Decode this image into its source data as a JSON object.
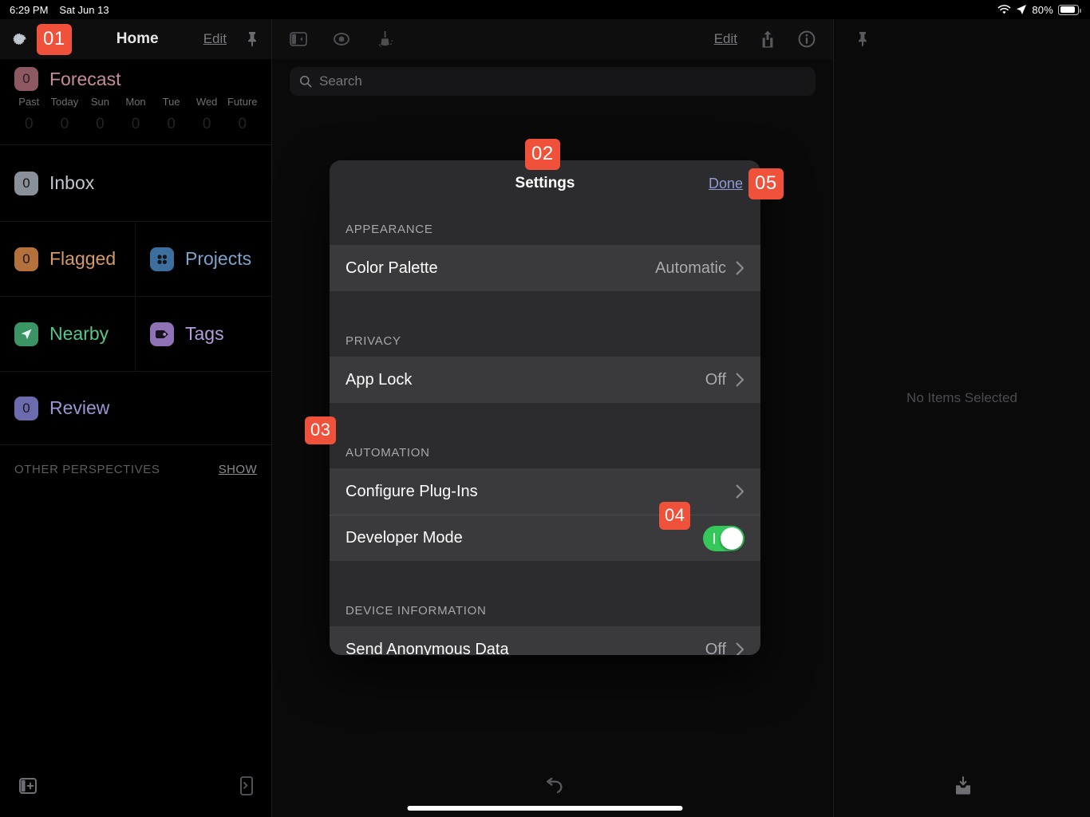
{
  "status_bar": {
    "time": "6:29 PM",
    "date": "Sat Jun 13",
    "wifi_icon": "wifi-icon",
    "location_icon": "location-arrow-icon",
    "battery_percent": "80%",
    "battery_icon": "battery-icon"
  },
  "sidebar": {
    "header": {
      "gear_icon": "gear-icon",
      "callout_badge": "01",
      "title": "Home",
      "edit_label": "Edit",
      "pin_icon": "pin-icon"
    },
    "forecast": {
      "count": "0",
      "label": "Forecast",
      "days": [
        {
          "label": "Past",
          "count": "0"
        },
        {
          "label": "Today",
          "count": "0"
        },
        {
          "label": "Sun",
          "count": "0"
        },
        {
          "label": "Mon",
          "count": "0"
        },
        {
          "label": "Tue",
          "count": "0"
        },
        {
          "label": "Wed",
          "count": "0"
        },
        {
          "label": "Future",
          "count": "0"
        }
      ]
    },
    "perspectives": [
      {
        "name": "inbox",
        "label": "Inbox",
        "count": "0",
        "chip_color": "#8a9099",
        "text_color": "#c2c7cf",
        "icon": "count-badge"
      },
      {
        "name": "flagged",
        "label": "Flagged",
        "count": "0",
        "chip_color": "#b5713c",
        "text_color": "#d79a63",
        "icon": "count-badge"
      },
      {
        "name": "projects",
        "label": "Projects",
        "count": "",
        "chip_color": "#3c6e9e",
        "text_color": "#7ba4cc",
        "icon": "projects-icon"
      },
      {
        "name": "nearby",
        "label": "Nearby",
        "count": "",
        "chip_color": "#3a9465",
        "text_color": "#55c78c",
        "icon": "nearby-icon"
      },
      {
        "name": "tags",
        "label": "Tags",
        "count": "",
        "chip_color": "#8f72b5",
        "text_color": "#b79ddc",
        "icon": "tags-icon"
      },
      {
        "name": "review",
        "label": "Review",
        "count": "0",
        "chip_color": "#6b6bae",
        "text_color": "#9898d6",
        "icon": "count-badge"
      }
    ],
    "forecast_chip_color": "#8c5861",
    "forecast_text_color": "#c98d97",
    "other_perspectives": {
      "title": "OTHER PERSPECTIVES",
      "show_label": "SHOW"
    },
    "bottom_bar": {
      "add_perspective_icon": "sidebar-add-icon",
      "console_icon": "console-icon"
    }
  },
  "middle_pane": {
    "toolbar": {
      "sidebar_toggle_icon": "sidebar-toggle-icon",
      "view_icon": "eye-view-icon",
      "cleanup_icon": "broom-cleanup-icon",
      "edit_label": "Edit",
      "share_icon": "share-icon",
      "info_icon": "info-icon"
    },
    "search": {
      "placeholder": "Search",
      "value": "",
      "icon": "search-icon"
    },
    "bottom_bar": {
      "undo_icon": "undo-icon"
    }
  },
  "right_pane": {
    "toolbar": {
      "pin_icon": "pin-icon"
    },
    "empty_state": "No Items Selected",
    "bottom_bar": {
      "inbox_add_icon": "inbox-add-icon"
    }
  },
  "settings_modal": {
    "title": "Settings",
    "done_label": "Done",
    "sections": [
      {
        "header": "APPEARANCE",
        "rows": [
          {
            "label": "Color Palette",
            "value": "Automatic",
            "type": "disclosure"
          }
        ]
      },
      {
        "header": "PRIVACY",
        "rows": [
          {
            "label": "App Lock",
            "value": "Off",
            "type": "disclosure"
          }
        ]
      },
      {
        "header": "AUTOMATION",
        "rows": [
          {
            "label": "Configure Plug-Ins",
            "value": "",
            "type": "disclosure"
          },
          {
            "label": "Developer Mode",
            "value": "",
            "type": "toggle",
            "toggle_on": true
          }
        ]
      },
      {
        "header": "DEVICE INFORMATION",
        "rows": [
          {
            "label": "Send Anonymous Data",
            "value": "Off",
            "type": "disclosure"
          }
        ]
      }
    ]
  },
  "callouts": {
    "c01": "01",
    "c02": "02",
    "c03": "03",
    "c04": "04",
    "c05": "05"
  },
  "colors": {
    "callout_badge": "#ef513a",
    "toggle_on": "#34c759",
    "done_link": "#8f9ad6",
    "modal_bg": "#2c2c2e",
    "modal_row_bg": "#3a3a3c"
  }
}
